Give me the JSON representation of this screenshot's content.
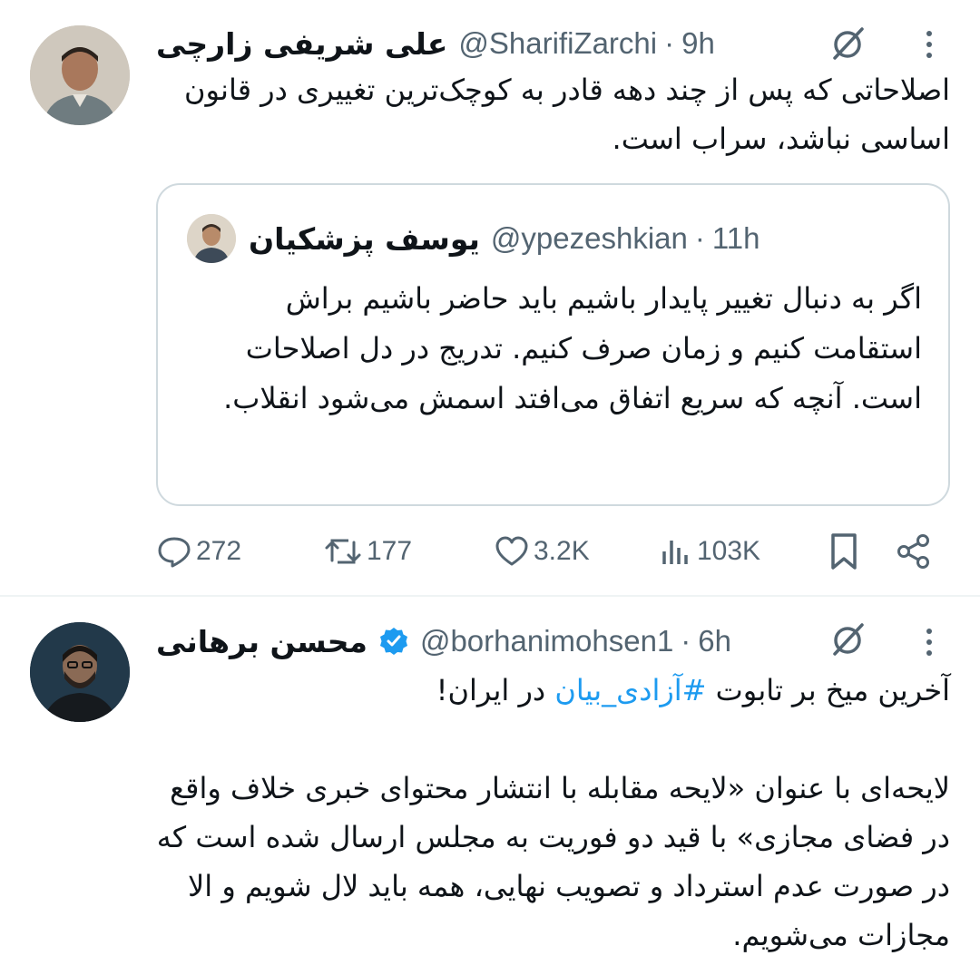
{
  "tweets": [
    {
      "author_name": "علی شریفی زارچی",
      "handle": "@SharifiZarchi",
      "separator": "·",
      "time": "9h",
      "text": "اصلاحاتی که پس از چند دهه قادر به کوچک‌ترین تغییری در قانون اساسی نباشد، سراب است.",
      "quote": {
        "author_name": "یوسف پزشکیان",
        "handle": "@ypezeshkian",
        "separator": "·",
        "time": "11h",
        "text": "اگر به دنبال تغییر پایدار باشیم باید حاضر باشیم براش استقامت کنیم و زمان صرف کنیم. تدریج در دل اصلاحات است. آنچه که سریع اتفاق می‌افتد اسمش می‌شود انقلاب."
      },
      "stats": {
        "replies": "272",
        "reposts": "177",
        "likes": "3.2K",
        "views": "103K"
      }
    },
    {
      "author_name": "محسن برهانی",
      "verified": true,
      "handle": "@borhanimohsen1",
      "separator": "·",
      "time": "6h",
      "text_line1_before": "آخرین میخ بر تابوت ",
      "hashtag": "#آزادی_بیان",
      "text_line1_after": " در ایران!",
      "paragraph2": "لایحه‌ای با عنوان «لایحه مقابله با انتشار محتوای خبری خلاف واقع در فضای مجازی» با قید دو فوریت به مجلس ارسال شده است که در صورت عدم استرداد و تصویب نهایی، همه باید لال شویم و الا مجازات می‌شویم."
    }
  ],
  "icons": {
    "grok": "slashed-circle-icon",
    "more": "vertical-ellipsis-icon",
    "reply": "speech-bubble-icon",
    "repost": "repost-arrows-icon",
    "like": "heart-icon",
    "views": "bar-chart-icon",
    "bookmark": "bookmark-icon",
    "share": "share-icon",
    "verified": "verified-badge-icon"
  },
  "colors": {
    "text": "#0f1419",
    "secondary": "#536471",
    "accent": "#1d9bf0",
    "border": "#cfd9de"
  }
}
